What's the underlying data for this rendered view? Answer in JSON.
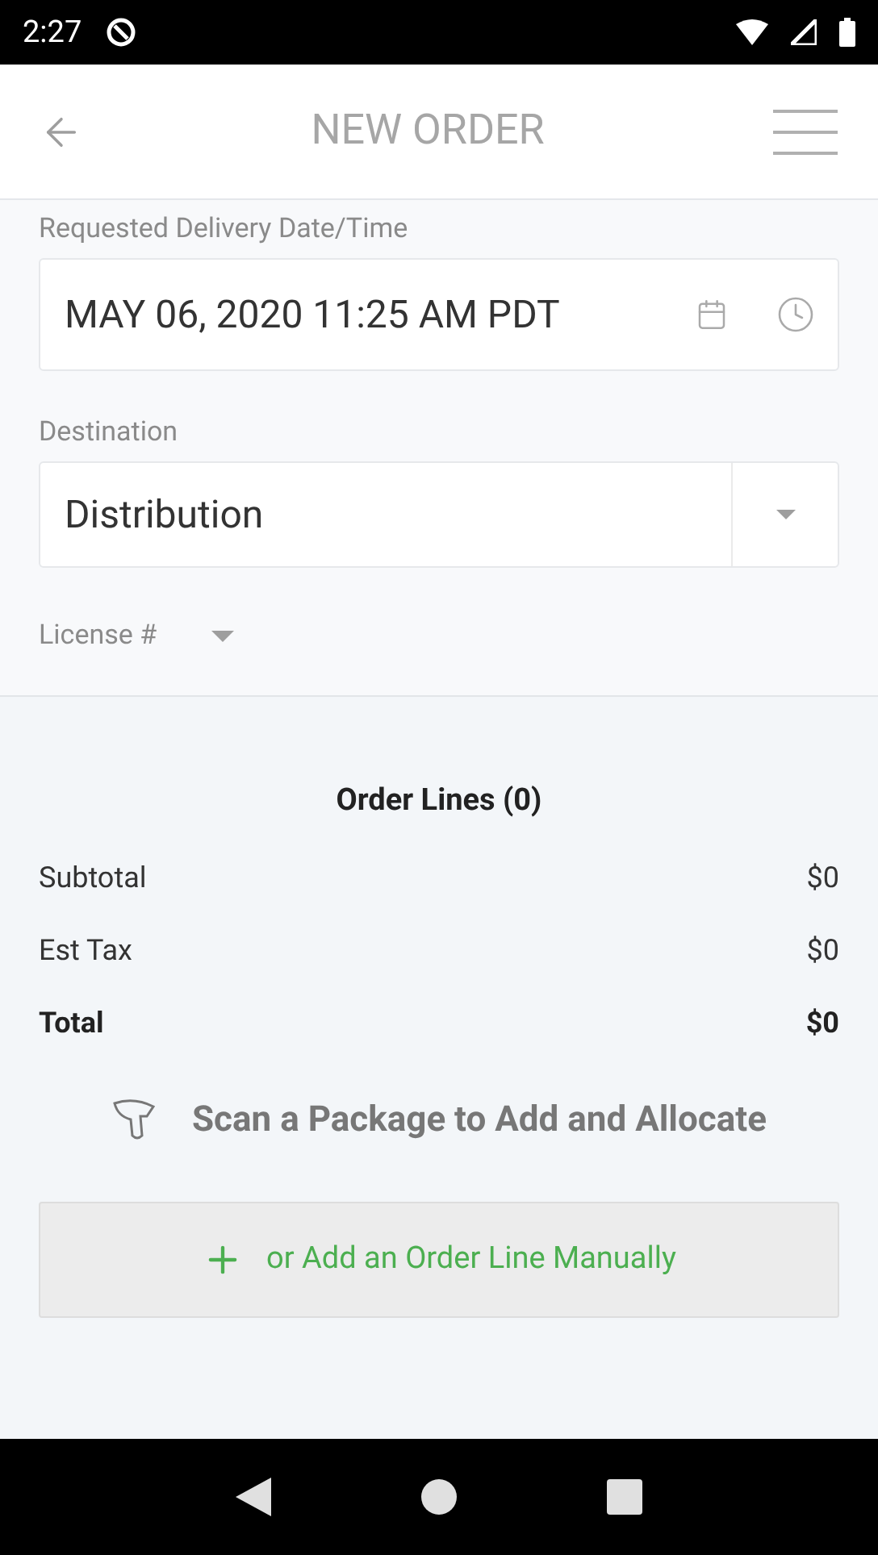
{
  "status_bar": {
    "time": "2:27"
  },
  "header": {
    "title": "NEW ORDER"
  },
  "delivery": {
    "label": "Requested Delivery Date/Time",
    "value": "MAY 06, 2020 11:25 AM PDT"
  },
  "destination": {
    "label": "Destination",
    "value": "Distribution"
  },
  "license": {
    "label": "License #"
  },
  "order_lines": {
    "title": "Order Lines (0)"
  },
  "totals": [
    {
      "label": "Subtotal",
      "value": "$0",
      "bold": false
    },
    {
      "label": "Est Tax",
      "value": "$0",
      "bold": false
    },
    {
      "label": "Total",
      "value": "$0",
      "bold": true
    }
  ],
  "scan_prompt": "Scan a Package to Add and Allocate",
  "add_button": "or Add an Order Line Manually"
}
